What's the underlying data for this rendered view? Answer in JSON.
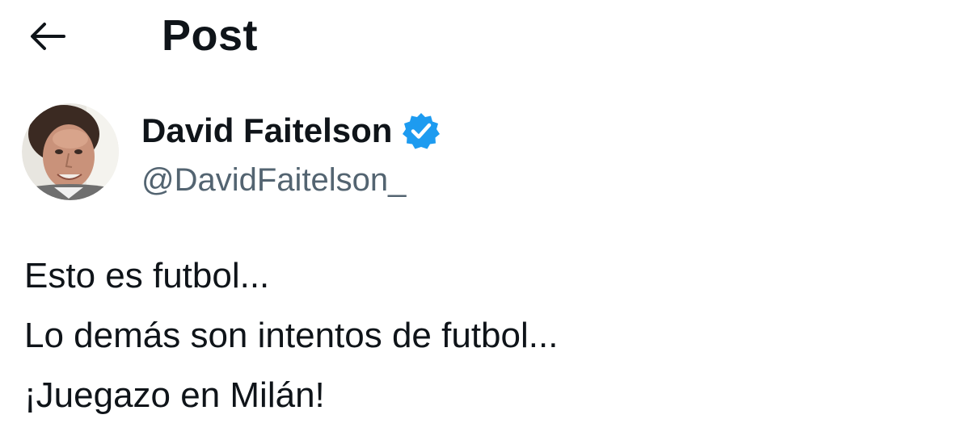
{
  "header": {
    "back_icon": "arrow-left-icon",
    "title": "Post"
  },
  "author": {
    "avatar_icon": "avatar-photo",
    "display_name": "David Faitelson",
    "verified_icon": "verified-badge-icon",
    "handle": "@DavidFaitelson_"
  },
  "post": {
    "lines": [
      "Esto es futbol...",
      "Lo demás son intentos de futbol...",
      "¡Juegazo en Milán!"
    ]
  },
  "colors": {
    "text": "#0f1419",
    "secondary_text": "#536471",
    "verified_blue": "#1d9bf0",
    "background": "#ffffff"
  }
}
